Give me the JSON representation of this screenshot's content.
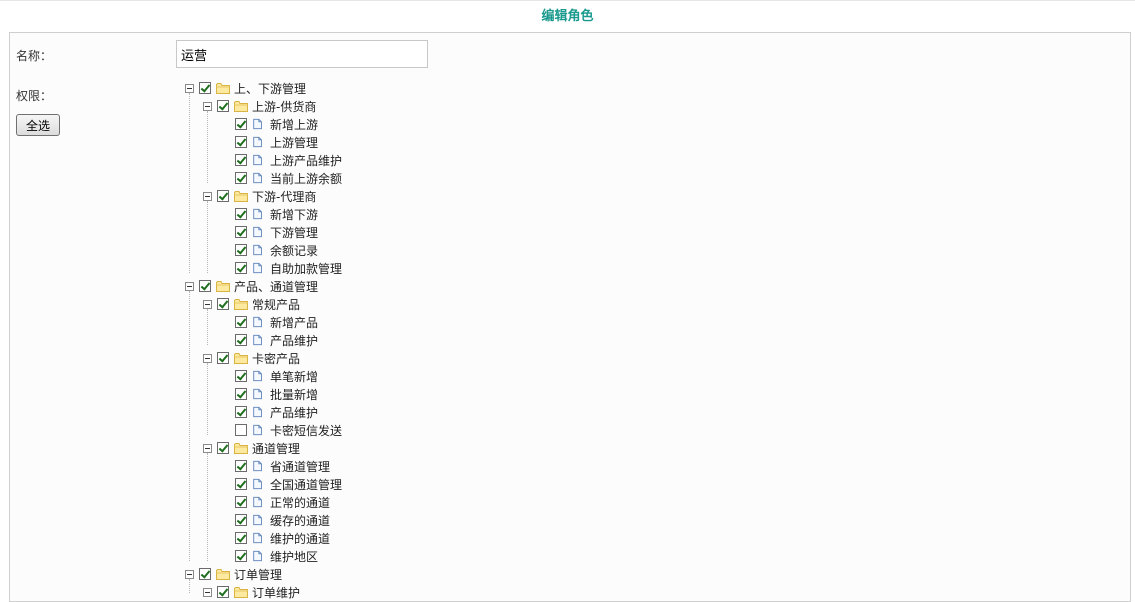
{
  "page": {
    "title": "编辑角色"
  },
  "form": {
    "name_label": "名称：",
    "name_value": "运营",
    "perm_label": "权限：",
    "select_all": "全选"
  },
  "tree": [
    {
      "label": "上、下游管理",
      "type": "folder",
      "checked": true,
      "children": [
        {
          "label": "上游-供货商",
          "type": "folder",
          "checked": true,
          "children": [
            {
              "label": "新增上游",
              "type": "file",
              "checked": true
            },
            {
              "label": "上游管理",
              "type": "file",
              "checked": true
            },
            {
              "label": "上游产品维护",
              "type": "file",
              "checked": true
            },
            {
              "label": "当前上游余额",
              "type": "file",
              "checked": true
            }
          ]
        },
        {
          "label": "下游-代理商",
          "type": "folder",
          "checked": true,
          "children": [
            {
              "label": "新增下游",
              "type": "file",
              "checked": true
            },
            {
              "label": "下游管理",
              "type": "file",
              "checked": true
            },
            {
              "label": "余额记录",
              "type": "file",
              "checked": true
            },
            {
              "label": "自助加款管理",
              "type": "file",
              "checked": true
            }
          ]
        }
      ]
    },
    {
      "label": "产品、通道管理",
      "type": "folder",
      "checked": true,
      "children": [
        {
          "label": "常规产品",
          "type": "folder",
          "checked": true,
          "children": [
            {
              "label": "新增产品",
              "type": "file",
              "checked": true
            },
            {
              "label": "产品维护",
              "type": "file",
              "checked": true
            }
          ]
        },
        {
          "label": "卡密产品",
          "type": "folder",
          "checked": true,
          "children": [
            {
              "label": "单笔新增",
              "type": "file",
              "checked": true
            },
            {
              "label": "批量新增",
              "type": "file",
              "checked": true
            },
            {
              "label": "产品维护",
              "type": "file",
              "checked": true
            },
            {
              "label": "卡密短信发送",
              "type": "file",
              "checked": false
            }
          ]
        },
        {
          "label": "通道管理",
          "type": "folder",
          "checked": true,
          "children": [
            {
              "label": "省通道管理",
              "type": "file",
              "checked": true
            },
            {
              "label": "全国通道管理",
              "type": "file",
              "checked": true
            },
            {
              "label": "正常的通道",
              "type": "file",
              "checked": true
            },
            {
              "label": "缓存的通道",
              "type": "file",
              "checked": true
            },
            {
              "label": "维护的通道",
              "type": "file",
              "checked": true
            },
            {
              "label": "维护地区",
              "type": "file",
              "checked": true
            }
          ]
        }
      ]
    },
    {
      "label": "订单管理",
      "type": "folder",
      "checked": true,
      "children": [
        {
          "label": "订单维护",
          "type": "folder",
          "checked": true,
          "children": []
        }
      ]
    }
  ]
}
